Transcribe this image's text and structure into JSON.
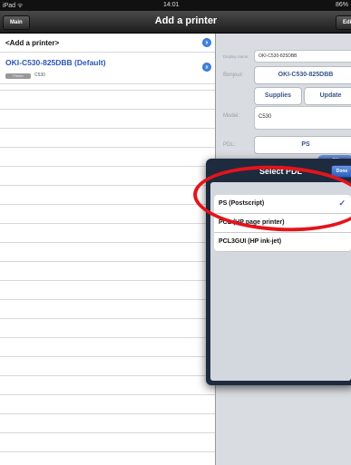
{
  "status_bar": {
    "carrier": "iPad ᯤ",
    "time": "14:01",
    "battery": "86%"
  },
  "nav": {
    "title": "Add a printer",
    "left_button": "Main",
    "right_button": "Edit"
  },
  "printer_list": {
    "add_item": "<Add a printer>",
    "printer_name": "OKI-C530-825DBB (Default)",
    "printer_tag": "Printer",
    "printer_model": "C530"
  },
  "detail": {
    "display_name_label": "Display name:",
    "display_name_value": "OKI-C530-825DBB",
    "bonjour_label": "Bonjour:",
    "bonjour_value": "OKI-C530-825DBB",
    "supplies_button": "Supplies",
    "update_button": "Update",
    "model_label": "Model:",
    "model_value": "C530",
    "pdl_label": "PDL:",
    "pdl_value": "PS",
    "toggle_on": "ON"
  },
  "pdl_popover": {
    "title": "Select PDL",
    "done_button": "Done",
    "options": [
      {
        "label": "PS (Postscript)",
        "selected": true
      },
      {
        "label": "PCL (HP page printer)",
        "selected": false
      },
      {
        "label": "PCL3GUI (HP ink-jet)",
        "selected": false
      }
    ],
    "check_mark": "✓"
  },
  "colors": {
    "annotation_ring": "#e4141b",
    "accent": "#1b5ec9"
  }
}
